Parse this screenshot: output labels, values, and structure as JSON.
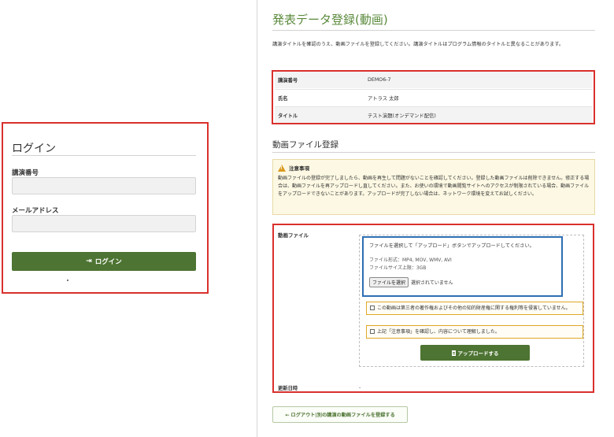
{
  "login": {
    "title": "ログイン",
    "talk_number_label": "講演番号",
    "email_label": "メールアドレス",
    "button_label": "ログイン",
    "button_icon": "sign-in-icon"
  },
  "page": {
    "title": "発表データ登録(動画)",
    "intro": "講演タイトルを確認のうえ、動画ファイルを登録してください。講演タイトルはプログラム情報のタイトルと異なることがあります。"
  },
  "info": {
    "rows": [
      {
        "key": "講演番号",
        "value": "DEMO6-7"
      },
      {
        "key": "氏名",
        "value": "アトラス 太郎"
      },
      {
        "key": "タイトル",
        "value": "テスト演題(オンデマンド配信)"
      }
    ]
  },
  "upload_section": {
    "title": "動画ファイル登録",
    "notice_title": "注意事項",
    "notice_body": "動画ファイルの登録が完了しましたら、動画を再生して問題がないことを確認してください。登録した動画ファイルは削除できません。修正する場合は、動画ファイルを再アップロードし直してください。また、お使いの環境で動画閲覧サイトへのアクセスが制限されている場合、動画ファイルをアップロードできないことがあります。アップロードが完了しない場合は、ネットワーク環境を変えてお試しください。",
    "field_label": "動画ファイル",
    "file_lead": "ファイルを選択して「アップロード」ボタンでアップロードしてください。",
    "file_format": "ファイル形式：MP4, MOV, WMV, AVI",
    "file_size": "ファイルサイズ上限：3GB",
    "choose_file_label": "ファイルを選択",
    "no_file_text": "選択されていません",
    "consent_1": "この動画は第三者の著作権およびその他の知的財産権に関する権利等を侵害していません。",
    "consent_2": "上記「注意事項」を確認し、内容について理解しました。",
    "upload_button_label": "アップロードする",
    "upload_icon": "document-icon",
    "updated_key": "更新日時",
    "updated_value": "-"
  },
  "footer": {
    "back_label": "← ログアウト|別の講演の動画ファイルを登録する"
  },
  "colors": {
    "accent_green": "#4d7432",
    "title_green": "#5b8a3c",
    "highlight_red": "#d9302c",
    "highlight_blue": "#2e6fb3"
  }
}
